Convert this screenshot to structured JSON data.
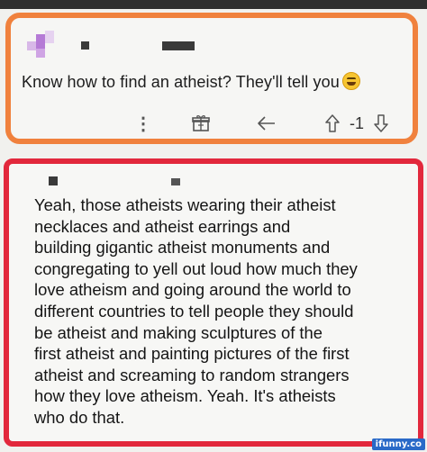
{
  "comment_1": {
    "text": "Know how to find an atheist? They'll tell you",
    "emoji": "grinning-squinting-face",
    "actions": {
      "more_icon": "vertical-ellipsis-icon",
      "more_symbol": "⋮",
      "award_icon": "gift-icon",
      "reply_icon": "reply-arrow-icon",
      "upvote_icon": "upvote-arrow-icon",
      "vote_count": "-1",
      "downvote_icon": "downvote-arrow-icon"
    }
  },
  "comment_2": {
    "lines": [
      "Yeah, those atheists wearing their atheist",
      "necklaces and atheist earrings and",
      "building gigantic atheist monuments and",
      "congregating to yell out loud how much they",
      "love atheism and going around the world to",
      "different countries to tell people they should",
      "be atheist and making sculptures of the",
      "first atheist and painting pictures of the first",
      "atheist and screaming to random strangers",
      "how they love atheism. Yeah. It's atheists",
      "who do that."
    ]
  },
  "watermark": "ifunny.co",
  "colors": {
    "orange_outline": "#f0813d",
    "red_outline": "#e2283c",
    "background": "#f1f1ee"
  }
}
